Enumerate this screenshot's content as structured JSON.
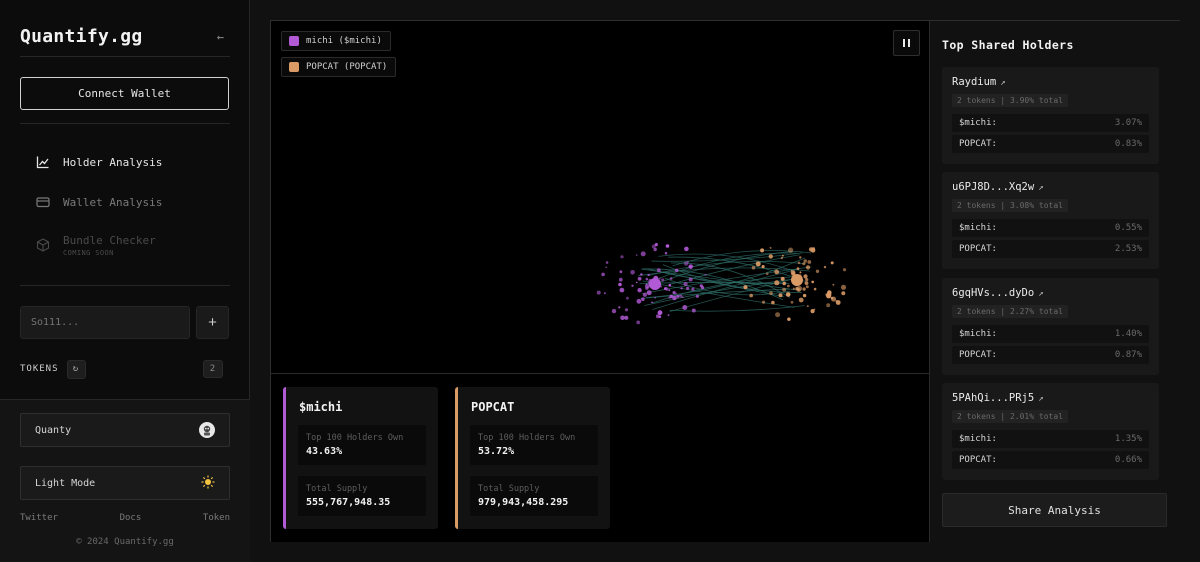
{
  "app": {
    "brand": "Quantify.gg",
    "connect_wallet": "Connect Wallet"
  },
  "nav": {
    "holder_analysis": "Holder Analysis",
    "wallet_analysis": "Wallet Analysis",
    "bundle_checker": "Bundle Checker",
    "coming_soon": "COMING SOON"
  },
  "search": {
    "placeholder": "So111..."
  },
  "tokens": {
    "label": "TOKENS",
    "count": "2"
  },
  "profile": {
    "name": "Quanty"
  },
  "theme": {
    "label": "Light Mode"
  },
  "footer": {
    "links": [
      "Twitter",
      "Docs",
      "Token"
    ],
    "copyright": "© 2024 Quantify.gg"
  },
  "legend": [
    {
      "label": "michi ($michi)",
      "color": "#b25ad6"
    },
    {
      "label": "POPCAT (POPCAT)",
      "color": "#d99a66"
    }
  ],
  "token_stats": [
    {
      "name": "$michi",
      "color": "#b25ad6",
      "holders_label": "Top 100 Holders Own",
      "holders_value": "43.63%",
      "supply_label": "Total Supply",
      "supply_value": "555,767,948.35"
    },
    {
      "name": "POPCAT",
      "color": "#d99a66",
      "holders_label": "Top 100 Holders Own",
      "holders_value": "53.72%",
      "supply_label": "Total Supply",
      "supply_value": "979,943,458.295"
    }
  ],
  "shared_holders": {
    "title": "Top Shared Holders",
    "items": [
      {
        "name": "Raydium",
        "meta": "2 tokens | 3.90% total",
        "rows": [
          {
            "token": "$michi:",
            "pct": "3.07%"
          },
          {
            "token": "POPCAT:",
            "pct": "0.83%"
          }
        ]
      },
      {
        "name": "u6PJ8D...Xq2w",
        "meta": "2 tokens | 3.08% total",
        "rows": [
          {
            "token": "$michi:",
            "pct": "0.55%"
          },
          {
            "token": "POPCAT:",
            "pct": "2.53%"
          }
        ]
      },
      {
        "name": "6gqHVs...dyDo",
        "meta": "2 tokens | 2.27% total",
        "rows": [
          {
            "token": "$michi:",
            "pct": "1.40%"
          },
          {
            "token": "POPCAT:",
            "pct": "0.87%"
          }
        ]
      },
      {
        "name": "5PAhQi...PRj5",
        "meta": "2 tokens | 2.01% total",
        "rows": [
          {
            "token": "$michi:",
            "pct": "1.35%"
          },
          {
            "token": "POPCAT:",
            "pct": "0.66%"
          }
        ]
      }
    ],
    "share_label": "Share Analysis"
  },
  "colors": {
    "michi": "#b25ad6",
    "popcat": "#d99a66",
    "link": "#2f6f6a"
  }
}
